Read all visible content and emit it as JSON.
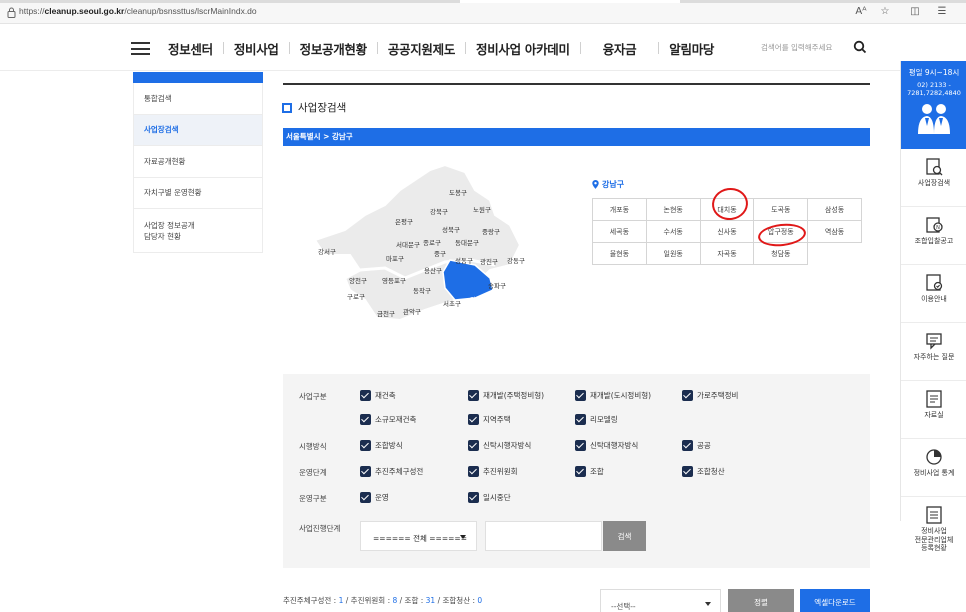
{
  "browser": {
    "url_prefix": "https://",
    "url_domain": "cleanup.seoul.go.kr",
    "url_path": "/cleanup/bsnssttus/lscrMainIndx.do",
    "reader_icon": "Aᴬ"
  },
  "nav": {
    "items": [
      "정보센터",
      "정비사업",
      "정보공개현황",
      "공공지원제도",
      "정비사업 아카데미",
      "융자금",
      "알림마당"
    ],
    "search_placeholder": "검색어를 입력해주세요"
  },
  "sidebar": {
    "items": [
      {
        "label": "통합검색"
      },
      {
        "label": "사업장검색"
      },
      {
        "label": "자료공개현황"
      },
      {
        "label": "자치구별 운영현황"
      },
      {
        "label_line1": "사업장 정보공개",
        "label_line2": "담당자 현황"
      }
    ]
  },
  "page": {
    "title": "사업장검색",
    "breadcrumb": "서울특별시 > 강남구"
  },
  "map": {
    "districts": [
      {
        "name": "도봉구"
      },
      {
        "name": "강북구"
      },
      {
        "name": "노원구"
      },
      {
        "name": "은평구"
      },
      {
        "name": "성북구"
      },
      {
        "name": "중랑구"
      },
      {
        "name": "종로구"
      },
      {
        "name": "동대문구"
      },
      {
        "name": "서대문구"
      },
      {
        "name": "중구"
      },
      {
        "name": "강서구"
      },
      {
        "name": "마포구"
      },
      {
        "name": "성동구"
      },
      {
        "name": "광진구"
      },
      {
        "name": "강동구"
      },
      {
        "name": "용산구"
      },
      {
        "name": "양천구"
      },
      {
        "name": "영등포구"
      },
      {
        "name": "구로구"
      },
      {
        "name": "동작구"
      },
      {
        "name": "송파구"
      },
      {
        "name": "강남구"
      },
      {
        "name": "서초구"
      },
      {
        "name": "금천구"
      },
      {
        "name": "관악구"
      }
    ],
    "selected": "강남구"
  },
  "dong": {
    "district_label": "강남구",
    "rows": [
      [
        "개포동",
        "논현동",
        "대치동",
        "도곡동",
        "삼성동"
      ],
      [
        "세곡동",
        "수서동",
        "신사동",
        "압구정동",
        "역삼동"
      ],
      [
        "율현동",
        "일원동",
        "자곡동",
        "청담동"
      ]
    ]
  },
  "filters": {
    "business_type": {
      "label": "사업구분",
      "options": [
        "재건축",
        "재개발(주택정비형)",
        "재개발(도시정비형)",
        "가로주택정비",
        "소규모재건축",
        "지역주택",
        "리모델링"
      ]
    },
    "method": {
      "label": "시행방식",
      "options": [
        "조합방식",
        "신탁시행자방식",
        "신탁대행자방식",
        "공공"
      ]
    },
    "operation_stage": {
      "label": "운영단계",
      "options": [
        "추진주체구성전",
        "추진위원회",
        "조합",
        "조합청산"
      ]
    },
    "operation_type": {
      "label": "운영구분",
      "options": [
        "운영",
        "일시중단"
      ]
    },
    "progress_stage": {
      "label": "사업진행단계",
      "selected": "====== 전체 ======"
    },
    "search_button": "검색"
  },
  "bottom": {
    "c1_label": "추진주체구성전 : ",
    "c1": "1",
    "c2_label": " / 추진위원회 : ",
    "c2": "8",
    "c3_label": " / 조합 : ",
    "c3": "31",
    "c4_label": " / 조합청산 : ",
    "c4": "0",
    "sort_select": "--선택--",
    "sort_button": "정렬",
    "excel_button": "엑셀다운로드"
  },
  "quick_menu": {
    "hours_line1": "평일 9시~18시",
    "phone_line1": "02) 2133 -",
    "phone_line2": "7281,7282,4840",
    "items": [
      {
        "label": "사업장검색"
      },
      {
        "label": "조합입찰공고"
      },
      {
        "label": "이용안내"
      },
      {
        "label": "자주하는 질문"
      },
      {
        "label": "자료실"
      },
      {
        "label": "정비사업 통계"
      },
      {
        "label_line1": "정비사업",
        "label_line2": "전문관리업체",
        "label_line3": "등록현황"
      }
    ]
  },
  "colors": {
    "accent": "#1e6ee6",
    "checkbox": "#1b2d4f",
    "annotation": "#e01818"
  }
}
